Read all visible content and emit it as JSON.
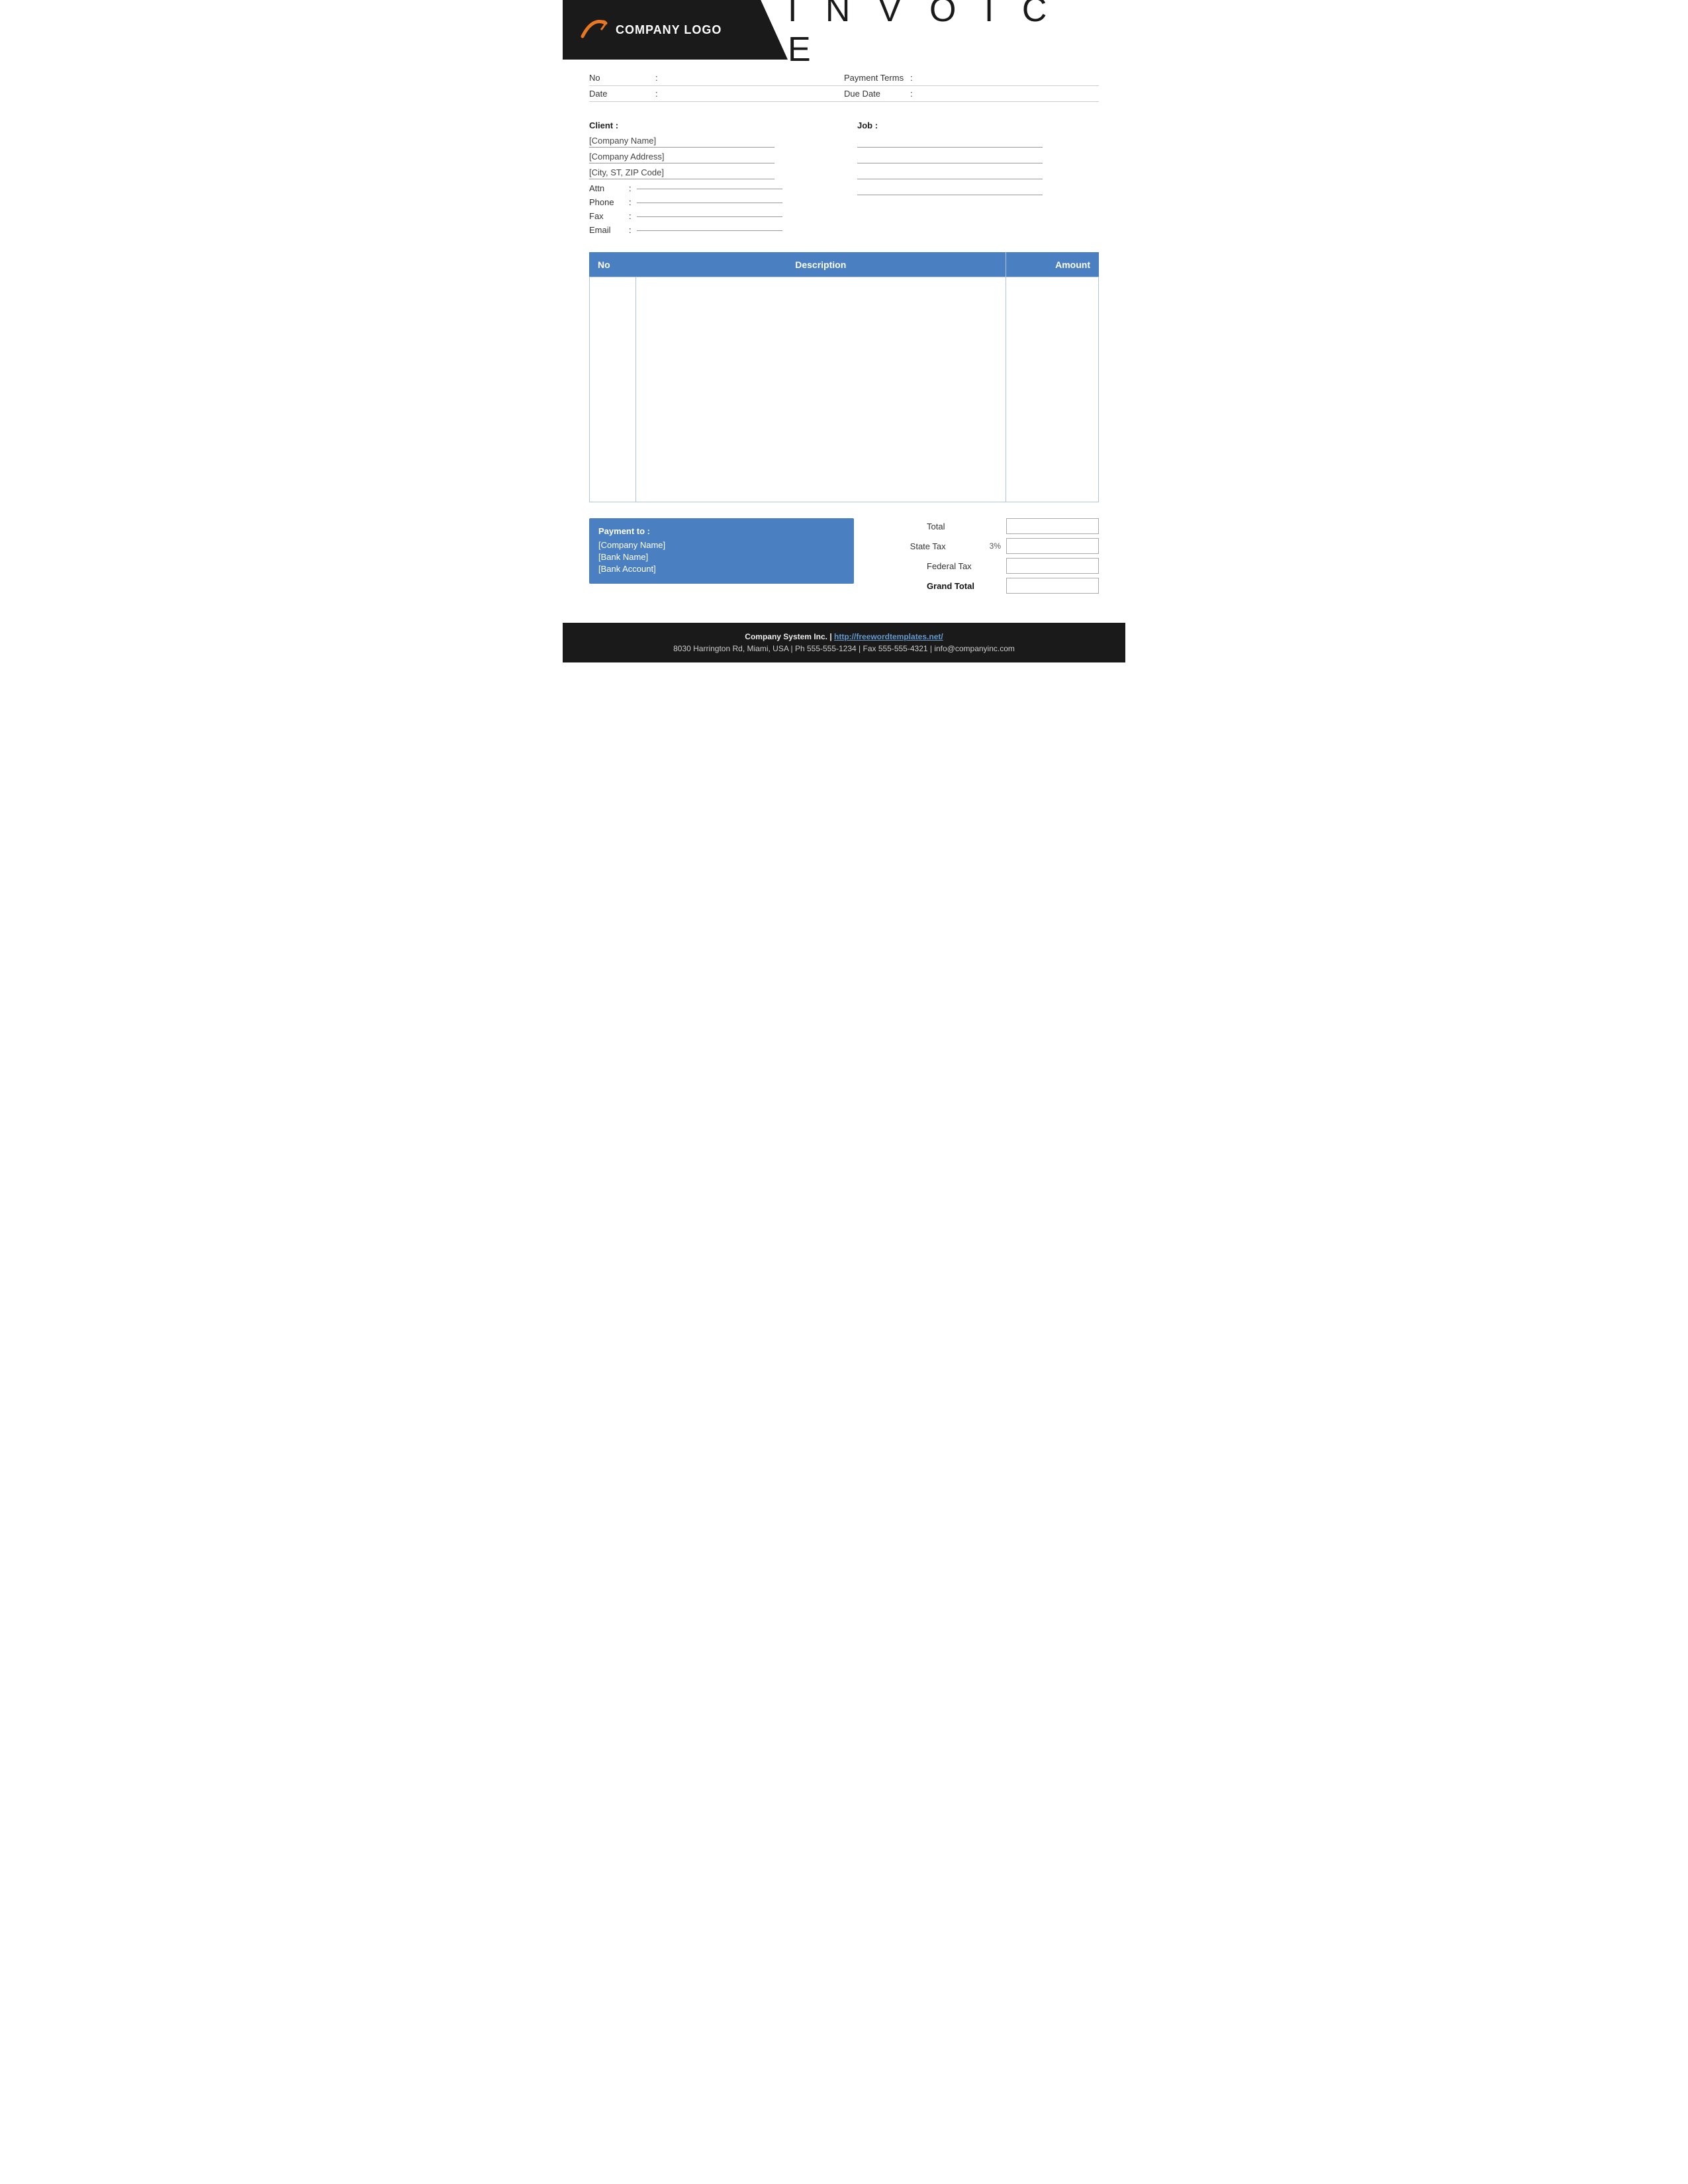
{
  "header": {
    "logo_text": "COMPANY LOGO",
    "invoice_title": "I N V O I C E"
  },
  "meta": {
    "no_label": "No",
    "no_colon": ":",
    "no_value": "",
    "payment_terms_label": "Payment  Terms",
    "payment_terms_colon": ":",
    "payment_terms_value": "",
    "date_label": "Date",
    "date_colon": ":",
    "date_value": "",
    "due_date_label": "Due Date",
    "due_date_colon": ":",
    "due_date_value": ""
  },
  "client": {
    "label": "Client :",
    "company_name": "[Company Name]",
    "company_address": "[Company Address]",
    "city_state_zip": "[City, ST, ZIP Code]",
    "attn_label": "Attn",
    "attn_colon": ":",
    "attn_value": "",
    "phone_label": "Phone",
    "phone_colon": ":",
    "phone_value": "",
    "fax_label": "Fax",
    "fax_colon": ":",
    "fax_value": "",
    "email_label": "Email",
    "email_colon": ":",
    "email_value": ""
  },
  "job": {
    "label": "Job  :",
    "lines": [
      "",
      "",
      "",
      ""
    ]
  },
  "table": {
    "col_no": "No",
    "col_description": "Description",
    "col_amount": "Amount"
  },
  "payment": {
    "title": "Payment to :",
    "company_name": "[Company Name]",
    "bank_name": "[Bank Name]",
    "bank_account": "[Bank Account]"
  },
  "totals": {
    "total_label": "Total",
    "state_tax_label": "State Tax",
    "state_tax_pct": "3%",
    "federal_tax_label": "Federal Tax",
    "grand_total_label": "Grand Total"
  },
  "footer": {
    "company_line": "Company System Inc. | http://freewordtemplates.net/",
    "address_line": "8030 Harrington Rd, Miami, USA | Ph 555-555-1234 | Fax 555-555-4321 | info@companyinc.com",
    "link_text": "http://freewordtemplates.net/"
  }
}
